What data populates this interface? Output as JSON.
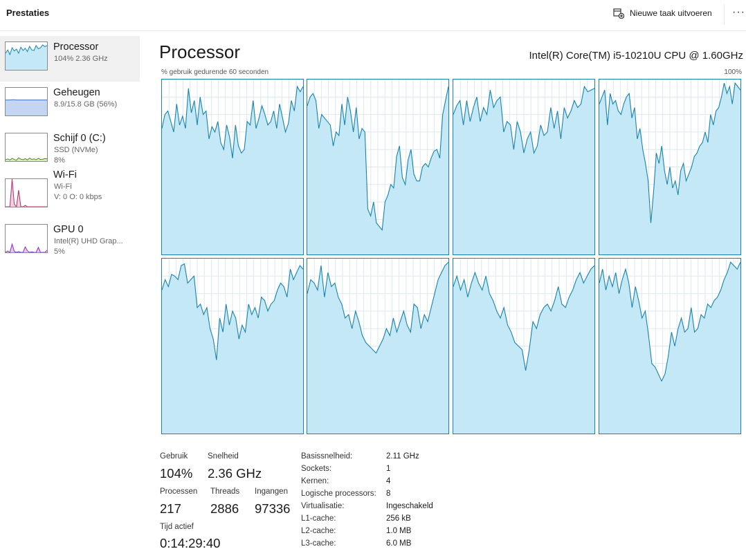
{
  "app": {
    "section_title": "Prestaties"
  },
  "toolbar": {
    "run_task_label": "Nieuwe taak uitvoeren",
    "more_label": "···"
  },
  "sidebar": {
    "items": [
      {
        "name": "Processor",
        "lines": [
          "104% 2.36 GHz"
        ],
        "color": "#1783ad",
        "fill": "#c5e8f7"
      },
      {
        "name": "Geheugen",
        "lines": [
          "8.9/15.8 GB (56%)"
        ],
        "color": "#3b6fc4",
        "fill": "#c4d5f3"
      },
      {
        "name": "Schijf 0 (C:)",
        "lines": [
          "SSD (NVMe)",
          "8%"
        ],
        "color": "#4d8a1f",
        "fill": "#d8ecc3"
      },
      {
        "name": "Wi-Fi",
        "lines": [
          "Wi-Fi",
          "V: 0 O: 0 kbps"
        ],
        "color": "#b0316f",
        "fill": "#f3cfe0"
      },
      {
        "name": "GPU 0",
        "lines": [
          "Intel(R) UHD Grap...",
          "5%"
        ],
        "color": "#8a2fc0",
        "fill": "#e2c8f2"
      }
    ]
  },
  "main": {
    "title": "Processor",
    "cpu_model": "Intel(R) Core(TM) i5-10210U CPU @ 1.60GHz",
    "graph_label": "% gebruik gedurende 60 seconden",
    "graph_max_label": "100%"
  },
  "stats": {
    "usage_label": "Gebruik",
    "usage_value": "104%",
    "speed_label": "Snelheid",
    "speed_value": "2.36 GHz",
    "processes_label": "Processen",
    "processes_value": "217",
    "threads_label": "Threads",
    "threads_value": "2886",
    "handles_label": "Ingangen",
    "handles_value": "97336",
    "uptime_label": "Tijd actief",
    "uptime_value": "0:14:29:40"
  },
  "specs": [
    {
      "key": "Basissnelheid:",
      "value": "2.11 GHz"
    },
    {
      "key": "Sockets:",
      "value": "1"
    },
    {
      "key": "Kernen:",
      "value": "4"
    },
    {
      "key": "Logische processors:",
      "value": "8"
    },
    {
      "key": "Virtualisatie:",
      "value": "Ingeschakeld"
    },
    {
      "key": "L1-cache:",
      "value": "256 kB"
    },
    {
      "key": "L2-cache:",
      "value": "1.0 MB"
    },
    {
      "key": "L3-cache:",
      "value": "6.0 MB"
    }
  ],
  "colors": {
    "cpu_line": "#1783ad",
    "cpu_fill": "#c5e8f7",
    "grid": "#dbe9f0"
  },
  "chart_data": {
    "type": "area",
    "y_range": [
      0,
      100
    ],
    "grid": true,
    "cores": [
      [
        72,
        80,
        82,
        76,
        70,
        86,
        74,
        79,
        72,
        95,
        81,
        88,
        74,
        90,
        80,
        82,
        66,
        73,
        70,
        76,
        64,
        60,
        74,
        67,
        55,
        74,
        62,
        58,
        60,
        76,
        74,
        88,
        72,
        78,
        85,
        80,
        74,
        76,
        82,
        72,
        86,
        78,
        70,
        75,
        88,
        82,
        96,
        93,
        96
      ],
      [
        85,
        90,
        92,
        88,
        72,
        80,
        78,
        76,
        74,
        62,
        70,
        68,
        86,
        74,
        90,
        82,
        70,
        84,
        66,
        72,
        70,
        26,
        22,
        30,
        18,
        16,
        14,
        30,
        34,
        40,
        38,
        56,
        62,
        44,
        40,
        54,
        60,
        46,
        42,
        42,
        50,
        52,
        50,
        55,
        59,
        60,
        55,
        80,
        88,
        96
      ],
      [
        80,
        85,
        88,
        74,
        88,
        76,
        84,
        90,
        76,
        84,
        80,
        94,
        84,
        88,
        90,
        70,
        76,
        74,
        60,
        76,
        70,
        58,
        66,
        70,
        58,
        62,
        74,
        68,
        70,
        84,
        72,
        82,
        66,
        84,
        78,
        82,
        88,
        84,
        86,
        96,
        93,
        94,
        95
      ],
      [
        86,
        90,
        94,
        74,
        92,
        86,
        88,
        82,
        80,
        86,
        90,
        92,
        78,
        84,
        66,
        72,
        60,
        52,
        42,
        18,
        36,
        58,
        52,
        62,
        48,
        40,
        50,
        38,
        42,
        34,
        48,
        52,
        42,
        46,
        50,
        56,
        58,
        62,
        64,
        70,
        64,
        80,
        74,
        82,
        84,
        90,
        98,
        92,
        96,
        86,
        98,
        96,
        94
      ],
      [
        82,
        88,
        84,
        91,
        90,
        88,
        96,
        97,
        86,
        88,
        90,
        72,
        74,
        68,
        72,
        60,
        54,
        42,
        66,
        58,
        74,
        62,
        70,
        66,
        54,
        62,
        58,
        74,
        68,
        72,
        66,
        78,
        76,
        70,
        74,
        76,
        82,
        86,
        84,
        78,
        94,
        88,
        92,
        96,
        94
      ],
      [
        80,
        88,
        86,
        82,
        96,
        78,
        92,
        84,
        86,
        78,
        74,
        66,
        68,
        60,
        70,
        64,
        56,
        52,
        50,
        48,
        46,
        50,
        54,
        60,
        56,
        66,
        58,
        64,
        70,
        62,
        58,
        74,
        72,
        60,
        68,
        64,
        72,
        80,
        88,
        92,
        96,
        98
      ],
      [
        84,
        90,
        82,
        88,
        78,
        86,
        92,
        86,
        82,
        90,
        80,
        76,
        70,
        66,
        72,
        62,
        58,
        52,
        50,
        48,
        36,
        48,
        64,
        60,
        68,
        72,
        74,
        70,
        76,
        84,
        74,
        72,
        78,
        82,
        88,
        92,
        86,
        90,
        94,
        96
      ],
      [
        86,
        94,
        82,
        90,
        84,
        92,
        80,
        88,
        94,
        86,
        72,
        84,
        76,
        66,
        70,
        56,
        40,
        38,
        34,
        30,
        34,
        44,
        58,
        50,
        60,
        66,
        58,
        60,
        72,
        58,
        60,
        68,
        66,
        74,
        72,
        76,
        78,
        82,
        88,
        92,
        98,
        96,
        94,
        98
      ]
    ]
  }
}
